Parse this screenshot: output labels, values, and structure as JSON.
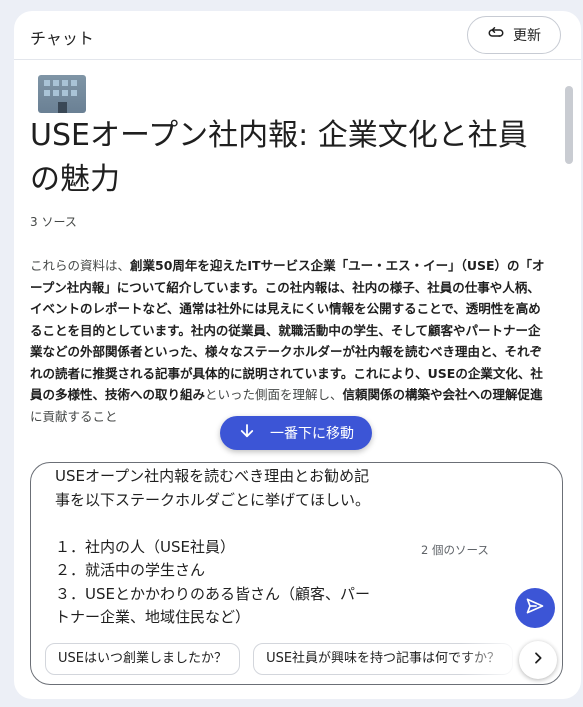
{
  "header": {
    "title": "チャット",
    "refresh_label": "更新"
  },
  "notebook": {
    "title": "USEオープン社内報: 企業文化と社員の魅力",
    "sources_count": "3 ソース",
    "summary": [
      {
        "t": "これらの資料は、",
        "s": "n"
      },
      {
        "t": "創業50周年を迎えたITサービス企業「ユー・エス・イー」（USE）の「オープン社内報」について紹介しています。この社内報は、社内の様子、社員の仕事や人柄、イベントのレポートなど、通常は社外には見えにくい情報を公開することで、透明性を高めることを目的としています。社内の従業員、就職活動中の学生、そして顧客やパートナー企業などの外部関係者といった、様々なステークホルダーが社内報を読むべき理由と、それぞれの読者に推奨される記事が具体的に説明されています。これにより、USEの企業文化、社員の多様性、技術への取り組み",
        "s": "b"
      },
      {
        "t": "といった側面を理解し、",
        "s": "n"
      },
      {
        "t": "信頼関係の構築や会社への理解促進",
        "s": "b"
      },
      {
        "t": "に貢献すること",
        "s": "n"
      }
    ]
  },
  "scroll_down_label": "一番下に移動",
  "input": {
    "query": "USEオープン社内報を読むべき理由とお勧め記\n事を以下ステークホルダごとに挙げてほしい。\n\n１．社内の人（USE社員）\n２．就活中の学生さん\n３．USEとかかわりのある皆さん（顧客、パー\nトナー企業、地域住民など）",
    "source_badge": "2 個のソース"
  },
  "suggestions": [
    "USEはいつ創業しましたか？",
    "USE社員が興味を持つ記事は何ですか？"
  ],
  "colors": {
    "accent": "#3c55d6",
    "background": "#eceff6"
  }
}
